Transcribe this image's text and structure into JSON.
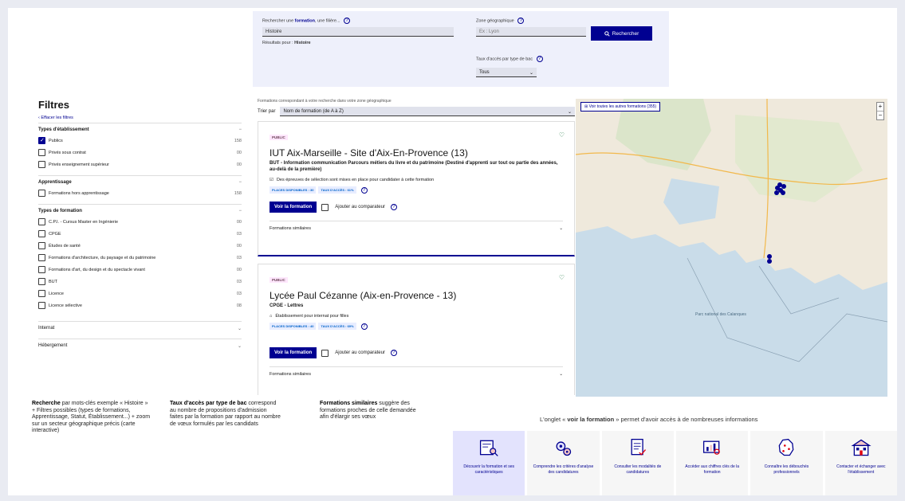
{
  "search": {
    "label_prefix": "Rechercher une",
    "label_bold": "formation",
    "label_suffix": ", une filière...",
    "value": "Histoire",
    "suggest_prefix": "Résultats pour :",
    "suggest_value": "Histoire",
    "zone_label": "Zone géographique",
    "zone_placeholder": "Ex : Lyon",
    "button_label": "Rechercher",
    "rate_label": "Taux d'accès par type de bac",
    "rate_value": "Tous"
  },
  "filters": {
    "title": "Filtres",
    "clear": "Effacer les filtres",
    "groups": [
      {
        "title": "Types d'établissement",
        "items": [
          {
            "label": "Publics",
            "count": "158",
            "checked": true
          },
          {
            "label": "Privés sous contrat",
            "count": "00",
            "checked": false
          },
          {
            "label": "Privés enseignement supérieur",
            "count": "00",
            "checked": false
          }
        ]
      },
      {
        "title": "Apprentissage",
        "items": [
          {
            "label": "Formations hors apprentissage",
            "count": "158",
            "checked": false
          }
        ]
      },
      {
        "title": "Types de formation",
        "items": [
          {
            "label": "C.P.I. - Cursus Master en Ingénierie",
            "count": "00",
            "checked": false
          },
          {
            "label": "CPGE",
            "count": "03",
            "checked": false
          },
          {
            "label": "Études de santé",
            "count": "00",
            "checked": false
          },
          {
            "label": "Formations d'architecture, du paysage et du patrimoine",
            "count": "03",
            "checked": false
          },
          {
            "label": "Formations d'art, du design et du spectacle vivant",
            "count": "00",
            "checked": false
          },
          {
            "label": "BUT",
            "count": "03",
            "checked": false
          },
          {
            "label": "Licence",
            "count": "03",
            "checked": false
          },
          {
            "label": "Licence sélective",
            "count": "08",
            "checked": false
          }
        ]
      },
      {
        "title": "Internat",
        "items": []
      },
      {
        "title": "Hébergement",
        "items": []
      }
    ]
  },
  "results": {
    "info": "Formations correspondant à votre recherche dans votre zone géographique",
    "sort_label": "Trier par",
    "sort_value": "Nom de formation (de A à Z)",
    "cards": [
      {
        "badge": "PUBLIC",
        "title": "IUT Aix-Marseille - Site d'Aix-En-Provence (13)",
        "subtitle": "BUT - Information communication Parcours métiers du livre et du patrimoine (Destiné d'apprenti sur tout ou partie des années, au-delà de la première)",
        "info": "Des épreuves de sélection sont mises en place pour candidater à cette formation",
        "tags": [
          "PLACES DISPONIBLES : 30",
          "TAUX D'ACCÈS : 61%"
        ],
        "view_label": "Voir la formation",
        "compare_label": "Ajouter au comparateur",
        "similar_label": "Formations similaires"
      },
      {
        "badge": "PUBLIC",
        "title": "Lycée Paul Cézanne (Aix-en-Provence - 13)",
        "subtitle": "CPGE - Lettres",
        "info": "Établissement pour internat pour filles",
        "tags": [
          "PLACES DISPONIBLES : 40",
          "TAUX D'ACCÈS : 69%"
        ],
        "view_label": "Voir la formation",
        "compare_label": "Ajouter au comparateur",
        "similar_label": "Formations similaires"
      }
    ]
  },
  "map": {
    "button_label": "Voir toutes les autres formations (355)",
    "zoom_in": "+",
    "zoom_out": "−",
    "sea_label": "Parc national des Calanques"
  },
  "annotations": {
    "recherche_bold": "Recherche",
    "recherche_text": " par mots-clés exemple « Histoire » + Filtres possibles (types de formations, Apprentissage, Statut, Établissement...) + zoom sur un secteur géographique précis (carte interactive)",
    "taux_bold": "Taux d'accès par type de bac",
    "taux_text": " correspond au nombre de propositions d'admission faites par la formation par rapport au nombre de vœux formulés par les candidats",
    "similaires_bold": "Formations similaires",
    "similaires_text": " suggère des formations proches de celle demandée afin d'élargir ses vœux",
    "onglet_prefix": "L'onglet « ",
    "onglet_bold": "voir la formation",
    "onglet_suffix": " » permet d'avoir accès à de nombreuses informations"
  },
  "features": [
    {
      "label": "Découvrir la formation et ses caractéristiques",
      "icon": "document-search-icon",
      "active": true
    },
    {
      "label": "Comprendre les critères d'analyse des candidatures",
      "icon": "gears-icon",
      "active": false
    },
    {
      "label": "Consulter les modalités de candidatures",
      "icon": "checklist-icon",
      "active": false
    },
    {
      "label": "Accéder aux chiffres clés de la formation",
      "icon": "chart-search-icon",
      "active": false
    },
    {
      "label": "Connaître les débouchés professionnels",
      "icon": "france-map-icon",
      "active": false
    },
    {
      "label": "Contacter et échanger avec l'établissement",
      "icon": "school-icon",
      "active": false
    }
  ],
  "colors": {
    "primary": "#000091",
    "accent": "#e3e3fd",
    "map_sea": "#c9dce9",
    "map_land": "#efe9dc"
  }
}
